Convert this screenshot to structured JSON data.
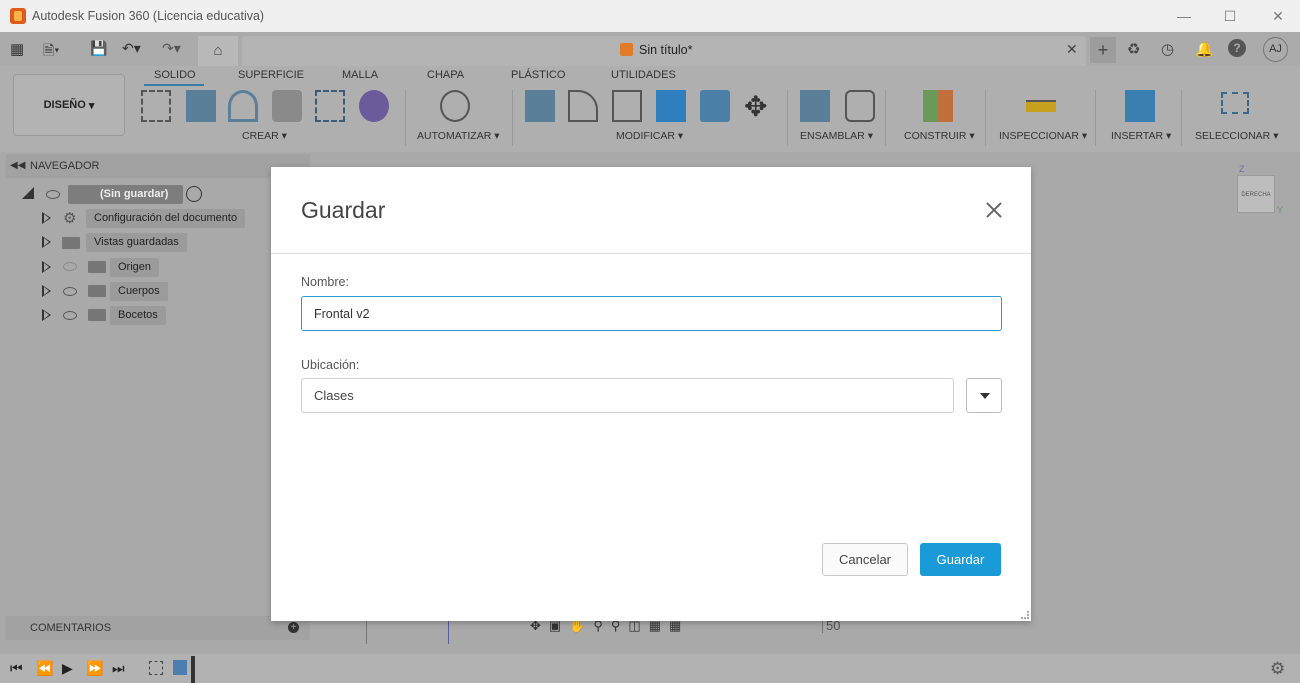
{
  "window": {
    "title": "Autodesk Fusion 360 (Licencia educativa)"
  },
  "doc_tab": {
    "title": "Sin título*"
  },
  "user": {
    "initials": "AJ"
  },
  "ribbon": {
    "tabs": [
      "SOLIDO",
      "SUPERFICIE",
      "MALLA",
      "CHAPA",
      "PLÁSTICO",
      "UTILIDADES"
    ],
    "workspace": "DISEÑO",
    "groups": [
      "CREAR",
      "AUTOMATIZAR",
      "MODIFICAR",
      "ENSAMBLAR",
      "CONSTRUIR",
      "INSPECCIONAR",
      "INSERTAR",
      "SELECCIONAR"
    ]
  },
  "navigator": {
    "header": "NAVEGADOR",
    "root": "(Sin guardar)",
    "items": [
      "Configuración del documento",
      "Vistas guardadas",
      "Origen",
      "Cuerpos",
      "Bocetos"
    ]
  },
  "comments": {
    "label": "COMENTARIOS"
  },
  "viewcube": {
    "face": "DERECHA",
    "axis_z": "Z",
    "axis_y": "Y"
  },
  "ruler": {
    "value": "50"
  },
  "dialog": {
    "title": "Guardar",
    "name_label": "Nombre:",
    "name_value": "Frontal v2",
    "location_label": "Ubicación:",
    "location_value": "Clases",
    "cancel_label": "Cancelar",
    "save_label": "Guardar"
  }
}
